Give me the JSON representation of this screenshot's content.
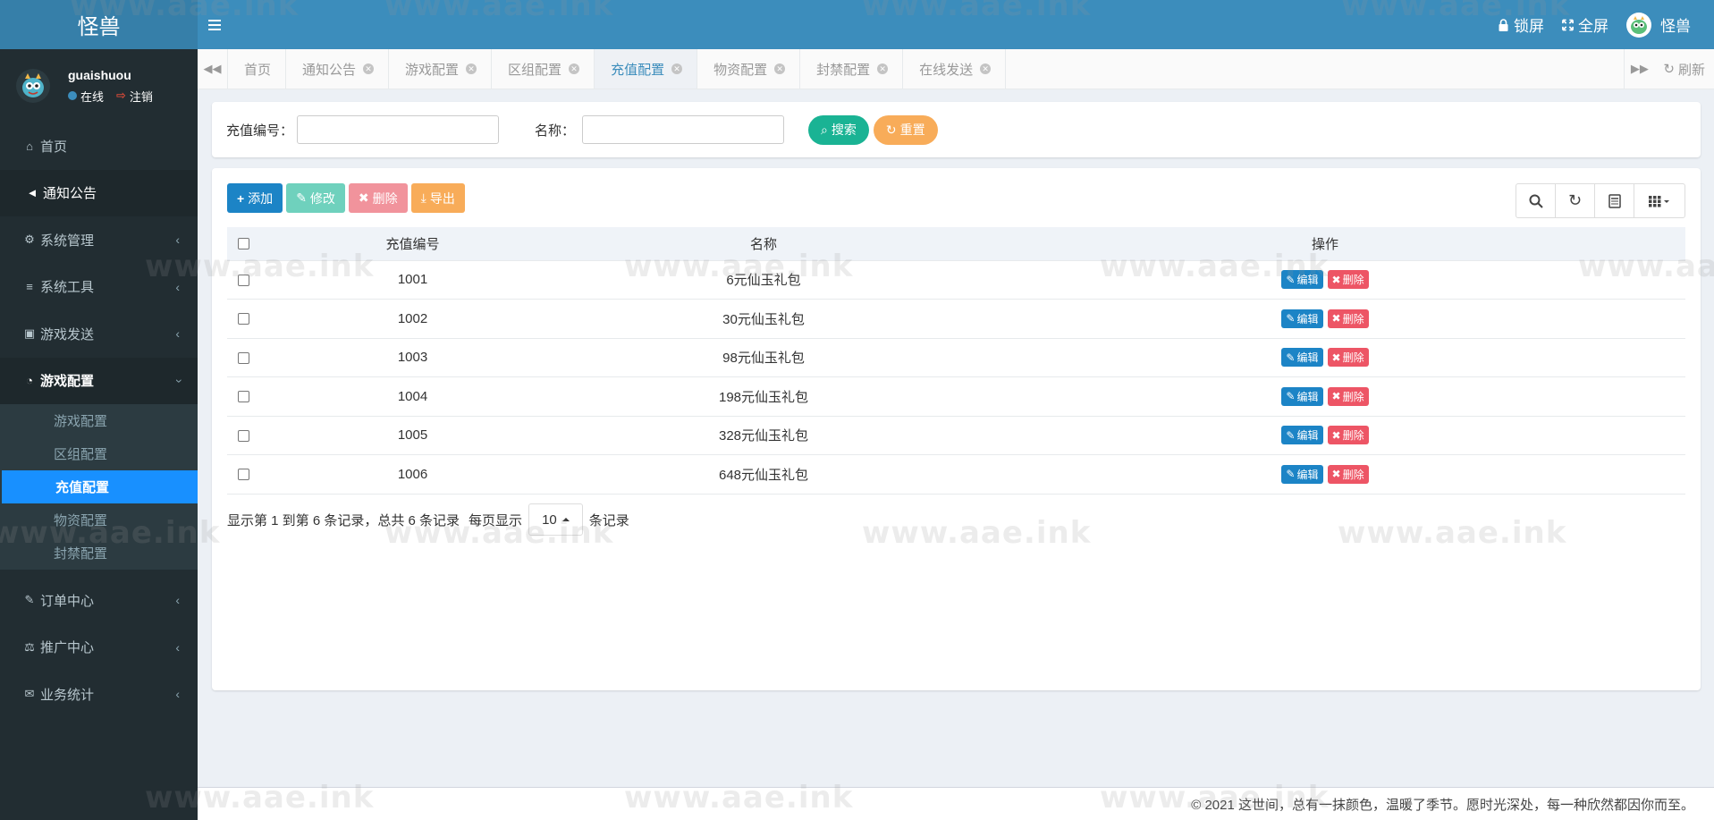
{
  "app": {
    "logo": "怪兽",
    "lock_label": "锁屏",
    "fullscreen_label": "全屏",
    "top_user": "怪兽"
  },
  "user": {
    "name": "guaishuou",
    "status": "在线",
    "logout": "注销"
  },
  "sidebar": {
    "items": [
      {
        "label": "首页",
        "icon": "home-icon"
      },
      {
        "label": "通知公告",
        "icon": "bullhorn-icon"
      },
      {
        "label": "系统管理",
        "icon": "gear-icon"
      },
      {
        "label": "系统工具",
        "icon": "bars-icon"
      },
      {
        "label": "游戏发送",
        "icon": "gift-icon"
      },
      {
        "label": "游戏配置",
        "icon": "dashboard-icon"
      },
      {
        "label": "订单中心",
        "icon": "pencil-icon"
      },
      {
        "label": "推广中心",
        "icon": "handshake-icon"
      },
      {
        "label": "业务统计",
        "icon": "envelope-icon"
      }
    ],
    "submenu": [
      "游戏配置",
      "区组配置",
      "充值配置",
      "物资配置",
      "封禁配置"
    ]
  },
  "tabs": {
    "items": [
      "首页",
      "通知公告",
      "游戏配置",
      "区组配置",
      "充值配置",
      "物资配置",
      "封禁配置",
      "在线发送"
    ],
    "refresh": "刷新"
  },
  "search": {
    "code_label": "充值编号：",
    "code_value": "",
    "name_label": "名称：",
    "name_value": "",
    "search_btn": "搜索",
    "reset_btn": "重置"
  },
  "toolbar": {
    "add": "添加",
    "edit": "修改",
    "delete": "删除",
    "export": "导出"
  },
  "table": {
    "headers": [
      "充值编号",
      "名称",
      "操作"
    ],
    "rows": [
      {
        "code": "1001",
        "name": "6元仙玉礼包"
      },
      {
        "code": "1002",
        "name": "30元仙玉礼包"
      },
      {
        "code": "1003",
        "name": "98元仙玉礼包"
      },
      {
        "code": "1004",
        "name": "198元仙玉礼包"
      },
      {
        "code": "1005",
        "name": "328元仙玉礼包"
      },
      {
        "code": "1006",
        "name": "648元仙玉礼包"
      }
    ],
    "edit_op": "编辑",
    "delete_op": "删除"
  },
  "pager": {
    "summary": "显示第 1 到第 6 条记录，总共 6 条记录",
    "per_page_prefix": "每页显示",
    "page_size": "10",
    "per_page_suffix": "条记录"
  },
  "footer": {
    "text": "© 2021 这世间，总有一抹颜色，温暖了季节。愿时光深处，每一种欣然都因你而至。"
  },
  "watermark": "www.aae.ink",
  "colors": {
    "header": "#3c8dbc",
    "sidebar": "#222d32",
    "active_submenu": "#1890ff",
    "primary": "#1c84c6",
    "danger": "#ed5565",
    "success": "#1ab394",
    "warning": "#f8ac59"
  }
}
